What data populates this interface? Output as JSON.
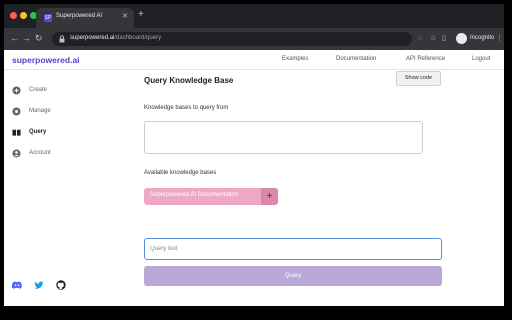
{
  "browser": {
    "tab_title": "Superpowered AI",
    "tab_favicon": "SP",
    "url_host": "superpowered.ai",
    "url_path": "/dashboard/query",
    "profile_label": "Incognito"
  },
  "topnav": {
    "logo": "superpowered.ai",
    "links": [
      "Examples",
      "Documentation",
      "API Reference",
      "Logout"
    ]
  },
  "sidebar": {
    "items": [
      {
        "label": "Create",
        "icon": "plus-circle-icon"
      },
      {
        "label": "Manage",
        "icon": "gear-icon"
      },
      {
        "label": "Query",
        "icon": "book-icon"
      },
      {
        "label": "Account",
        "icon": "user-icon"
      }
    ],
    "active": "Query",
    "social": [
      "discord-icon",
      "twitter-icon",
      "github-icon"
    ]
  },
  "main": {
    "title": "Query Knowledge Base",
    "show_code_label": "Show code",
    "kb_query_label": "Knowledge bases to query from",
    "available_label": "Available knowledge bases",
    "available_kbs": [
      "Superpowered AI Documentation"
    ],
    "query_placeholder": "Query text",
    "query_value": "",
    "query_button_label": "Query"
  },
  "colors": {
    "brand": "#5c3ec9",
    "chip": "#eda8c5",
    "query_button": "#b9a8d6",
    "focus_border": "#5a8fe0"
  }
}
